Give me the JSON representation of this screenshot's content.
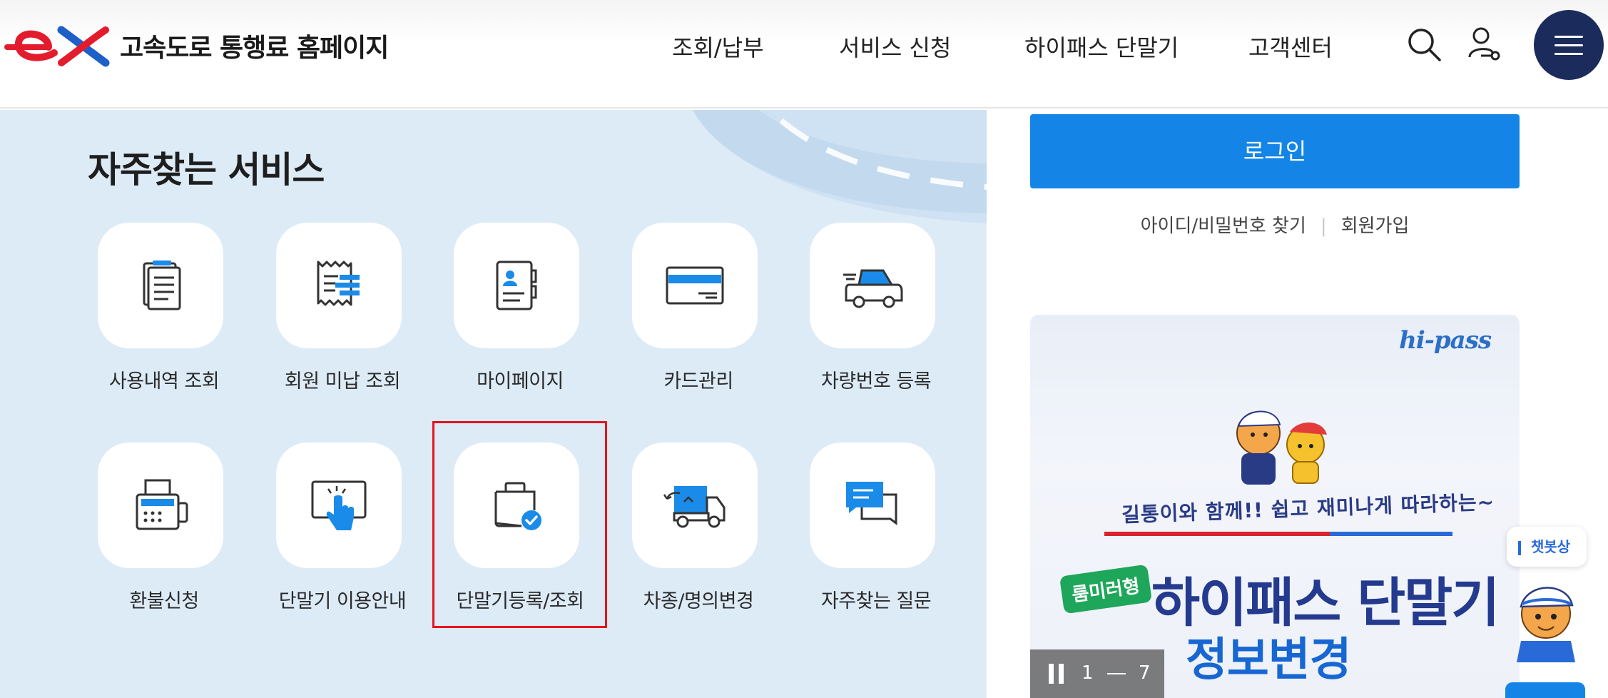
{
  "header": {
    "site_title": "고속도로 통행료 홈페이지",
    "nav": [
      "조회/납부",
      "서비스 신청",
      "하이패스 단말기",
      "고객센터"
    ],
    "icons": [
      "search-icon",
      "user-key-icon",
      "hamburger-menu-icon"
    ],
    "logo_icon": "ex-logo"
  },
  "services": {
    "title": "자주찾는 서비스",
    "items": [
      {
        "label": "사용내역 조회",
        "icon": "document-list-icon"
      },
      {
        "label": "회원 미납 조회",
        "icon": "receipt-icon"
      },
      {
        "label": "마이페이지",
        "icon": "contact-card-icon"
      },
      {
        "label": "카드관리",
        "icon": "credit-card-icon"
      },
      {
        "label": "차량번호 등록",
        "icon": "car-icon"
      },
      {
        "label": "환불신청",
        "icon": "cash-register-icon"
      },
      {
        "label": "단말기 이용안내",
        "icon": "touch-screen-icon"
      },
      {
        "label": "단말기등록/조회",
        "icon": "device-check-icon"
      },
      {
        "label": "차종/명의변경",
        "icon": "truck-icon"
      },
      {
        "label": "자주찾는 질문",
        "icon": "chat-bubbles-icon"
      }
    ],
    "highlighted": "단말기등록/조회"
  },
  "login": {
    "button": "로그인",
    "find_link": "아이디/비밀번호 찾기",
    "separator": "|",
    "join_link": "회원가입"
  },
  "banner": {
    "brand": "hi-pass",
    "subtitle": "길통이와 함께!! 쉽고 재미나게 따라하는~",
    "tag": "룸미러형",
    "title_line1": "하이패스 단말기",
    "title_line2": "정보변경",
    "pager": {
      "current": "1",
      "total": "7"
    }
  },
  "chatbot": {
    "label": "챗봇상"
  },
  "colors": {
    "brand_blue": "#1485e6",
    "navy": "#1b2b5b",
    "panel_bg": "#ddebf7",
    "highlight": "#e8141c",
    "logo_red": "#e31c2d",
    "logo_blue": "#1e5fc8"
  }
}
